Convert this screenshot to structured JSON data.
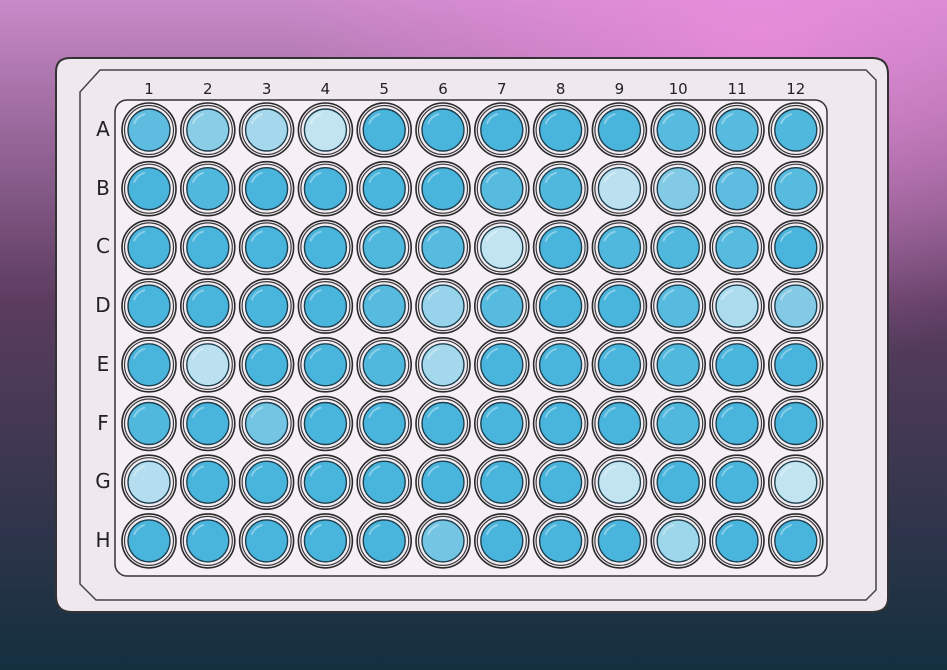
{
  "plate": {
    "columns": [
      "1",
      "2",
      "3",
      "4",
      "5",
      "6",
      "7",
      "8",
      "9",
      "10",
      "11",
      "12"
    ],
    "rows": [
      "A",
      "B",
      "C",
      "D",
      "E",
      "F",
      "G",
      "H"
    ],
    "colors": {
      "bg_top": "#c98ac9",
      "bg_mid": "#5b3c5f",
      "bg_bottom": "#13303f",
      "plate_fill": "#efe8ef",
      "plate_stroke": "#333333",
      "well_full": "#49b4dc",
      "well_light": "#d7ecf5"
    },
    "wells": [
      [
        0.15,
        0.45,
        0.65,
        0.85,
        0.0,
        0.0,
        0.0,
        0.0,
        0.0,
        0.1,
        0.1,
        0.05
      ],
      [
        0.0,
        0.05,
        0.0,
        0.0,
        0.0,
        0.0,
        0.1,
        0.05,
        0.8,
        0.4,
        0.15,
        0.1
      ],
      [
        0.0,
        0.0,
        0.0,
        0.0,
        0.05,
        0.1,
        0.85,
        0.0,
        0.05,
        0.05,
        0.1,
        0.0
      ],
      [
        0.0,
        0.0,
        0.0,
        0.0,
        0.1,
        0.55,
        0.1,
        0.0,
        0.0,
        0.1,
        0.7,
        0.4
      ],
      [
        0.0,
        0.8,
        0.0,
        0.0,
        0.05,
        0.65,
        0.0,
        0.0,
        0.0,
        0.05,
        0.0,
        0.0
      ],
      [
        0.05,
        0.0,
        0.3,
        0.0,
        0.0,
        0.0,
        0.0,
        0.0,
        0.0,
        0.05,
        0.0,
        0.0
      ],
      [
        0.75,
        0.0,
        0.0,
        0.0,
        0.0,
        0.0,
        0.0,
        0.0,
        0.85,
        0.0,
        0.0,
        0.85
      ],
      [
        0.0,
        0.0,
        0.0,
        0.0,
        0.0,
        0.3,
        0.0,
        0.0,
        0.0,
        0.6,
        0.0,
        0.0
      ]
    ]
  }
}
